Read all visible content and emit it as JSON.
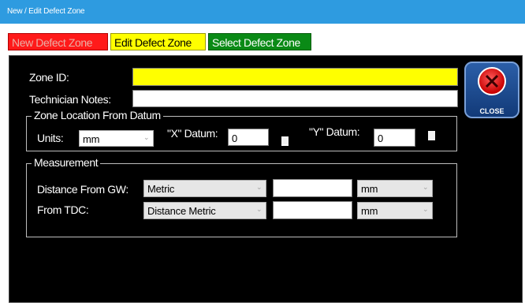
{
  "window": {
    "title": "New / Edit Defect Zone"
  },
  "tabs": [
    {
      "label": "New Defect Zone"
    },
    {
      "label": "Edit Defect Zone"
    },
    {
      "label": "Select Defect Zone"
    }
  ],
  "form": {
    "zone_id_label": "Zone ID:",
    "zone_id_value": "",
    "tech_notes_label": "Technician Notes:",
    "tech_notes_value": ""
  },
  "zone_location": {
    "legend": "Zone Location From Datum",
    "units_label": "Units:",
    "units_value": "mm",
    "x_datum_label": "\"X\" Datum:",
    "x_datum_value": "0",
    "y_datum_label": "\"Y\" Datum:",
    "y_datum_value": "0"
  },
  "measurement": {
    "legend": "Measurement",
    "distance_gw_label": "Distance From GW:",
    "distance_gw_type": "Metric",
    "distance_gw_value": "",
    "distance_gw_unit": "mm",
    "from_tdc_label": "From TDC:",
    "from_tdc_type": "Distance Metric",
    "from_tdc_value": "",
    "from_tdc_unit": "mm"
  },
  "close_button": {
    "label": "CLOSE",
    "icon": "close-x-icon"
  },
  "colors": {
    "titlebar": "#2e9be0",
    "tab_new": "#ff1a1a",
    "tab_edit": "#ffff00",
    "tab_select": "#0a8a16",
    "zone_id_field": "#ffff00"
  }
}
